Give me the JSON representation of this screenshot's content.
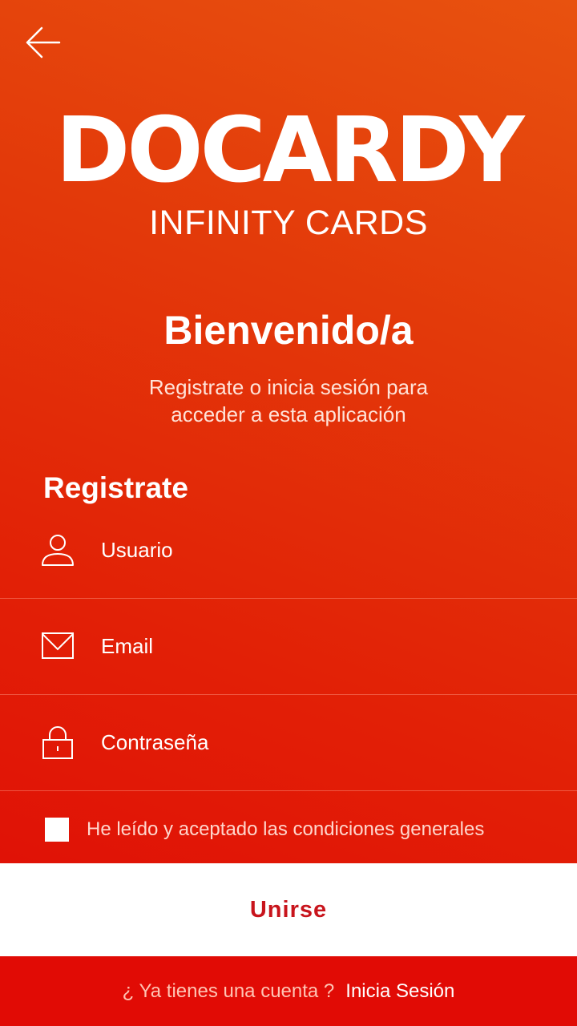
{
  "brand": {
    "logo_text": "DOCARDY",
    "tagline": "INFINITY CARDS"
  },
  "welcome": {
    "title": "Bienvenido/a",
    "subtitle_line1": "Registrate o inicia sesión para",
    "subtitle_line2": "acceder a esta aplicación"
  },
  "form": {
    "title": "Registrate",
    "username_label": "Usuario",
    "email_label": "Email",
    "password_label": "Contraseña",
    "consent_label": "He leído y aceptado las condiciones generales",
    "consent_checked": false,
    "submit_label": "Unirse"
  },
  "footer": {
    "question": "¿ Ya tienes una cuenta ?",
    "login_link": "Inicia Sesión"
  },
  "icons": [
    "back-arrow-icon",
    "user-icon",
    "envelope-icon",
    "lock-icon"
  ],
  "colors": {
    "gradient_top": "#e8520f",
    "gradient_bottom": "#df0a06",
    "accent": "#c8141c",
    "footer_bg": "#e10b05"
  }
}
